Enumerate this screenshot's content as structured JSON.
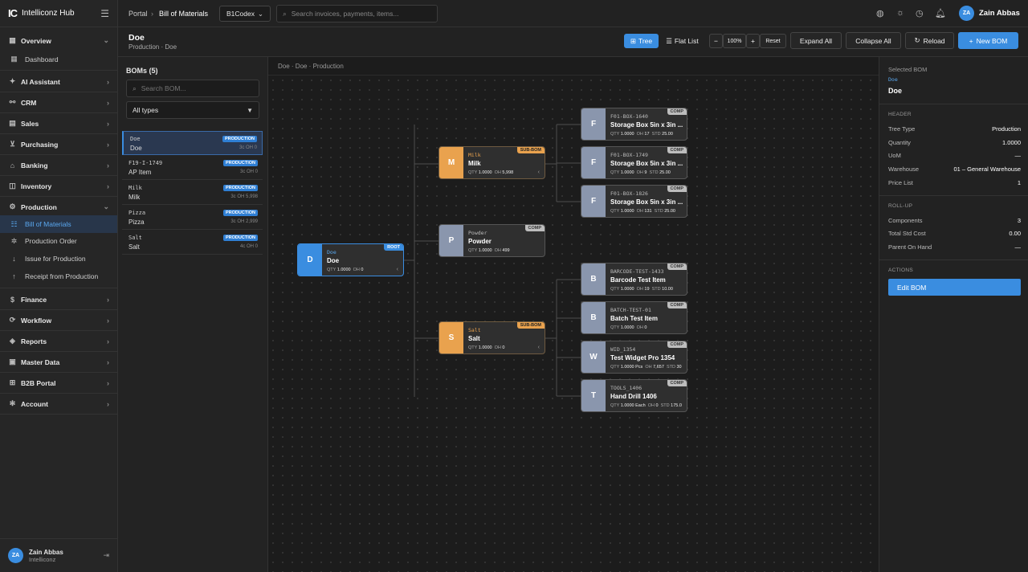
{
  "brand": {
    "logo": "IC",
    "name": "Intelliconz Hub"
  },
  "nav": {
    "groups": [
      {
        "label": "Overview",
        "icon": "grid-icon"
      },
      {
        "label": "AI Assistant",
        "icon": "sparkle-icon"
      },
      {
        "label": "CRM",
        "icon": "handshake-icon"
      },
      {
        "label": "Sales",
        "icon": "receipt-icon"
      },
      {
        "label": "Purchasing",
        "icon": "cart-icon"
      },
      {
        "label": "Banking",
        "icon": "bank-icon"
      },
      {
        "label": "Inventory",
        "icon": "box-icon"
      },
      {
        "label": "Production",
        "icon": "gear-icon"
      },
      {
        "label": "Finance",
        "icon": "dollar-icon"
      },
      {
        "label": "Workflow",
        "icon": "workflow-icon"
      },
      {
        "label": "Reports",
        "icon": "tag-icon"
      },
      {
        "label": "Master Data",
        "icon": "database-icon"
      },
      {
        "label": "B2B Portal",
        "icon": "portal-icon"
      },
      {
        "label": "Account",
        "icon": "settings-icon"
      }
    ],
    "sub_overview": [
      {
        "label": "Dashboard"
      }
    ],
    "sub_production": [
      {
        "label": "Bill of Materials"
      },
      {
        "label": "Production Order"
      },
      {
        "label": "Issue for Production"
      },
      {
        "label": "Receipt from Production"
      }
    ]
  },
  "user": {
    "initials": "ZA",
    "name": "Zain Abbas",
    "org": "Intelliconz"
  },
  "topbar": {
    "crumb_root": "Portal",
    "crumb_sep": "›",
    "crumb_page": "Bill of Materials",
    "company": "B1Codex",
    "search_placeholder": "Search invoices, payments, items..."
  },
  "page": {
    "title": "Doe",
    "subtitle": "Production · Doe"
  },
  "toolbar": {
    "tree": "Tree",
    "flat": "Flat List",
    "zoom_out": "−",
    "zoom": "100%",
    "zoom_in": "+",
    "reset": "Reset",
    "expand": "Expand All",
    "collapse": "Collapse All",
    "reload": "Reload",
    "new_bom": "New BOM"
  },
  "boms": {
    "header": "BOMs (5)",
    "search_placeholder": "Search BOM...",
    "type_filter": "All types",
    "items": [
      {
        "code": "Doe",
        "name": "Doe",
        "badge": "PRODUCTION",
        "meta": "3c OH 0"
      },
      {
        "code": "F19-I-1749",
        "name": "AP Item",
        "badge": "PRODUCTION",
        "meta": "3c OH 0"
      },
      {
        "code": "Milk",
        "name": "Milk",
        "badge": "PRODUCTION",
        "meta": "3c OH 5,998"
      },
      {
        "code": "Pizza",
        "name": "Pizza",
        "badge": "PRODUCTION",
        "meta": "3c OH 2,999"
      },
      {
        "code": "Salt",
        "name": "Salt",
        "badge": "PRODUCTION",
        "meta": "4c OH 0"
      }
    ]
  },
  "canvas": {
    "breadcrumb": "Doe · Doe · Production"
  },
  "tree": {
    "root": {
      "letter": "D",
      "code": "Doe",
      "title": "Doe",
      "tag": "ROOT",
      "qty": "1.0000",
      "oh": "0"
    },
    "level1": [
      {
        "letter": "M",
        "code": "Milk",
        "title": "Milk",
        "tag": "SUB-BOM",
        "qty": "1.0000",
        "oh": "5,998",
        "color": "orange"
      },
      {
        "letter": "P",
        "code": "Powder",
        "title": "Powder",
        "tag": "COMP",
        "qty": "1.0000",
        "oh": "499",
        "color": "gray"
      },
      {
        "letter": "S",
        "code": "Salt",
        "title": "Salt",
        "tag": "SUB-BOM",
        "qty": "1.0000",
        "oh": "0",
        "color": "orange"
      }
    ],
    "milk_children": [
      {
        "letter": "F",
        "code": "F01-BOX-1640",
        "title": "Storage Box 5in x 3in ...",
        "tag": "COMP",
        "qty": "1.0000",
        "oh": "17",
        "std": "25.00"
      },
      {
        "letter": "F",
        "code": "F01-BOX-1749",
        "title": "Storage Box 5in x 3in ...",
        "tag": "COMP",
        "qty": "1.0000",
        "oh": "9",
        "std": "25.00"
      },
      {
        "letter": "F",
        "code": "F01-BOX-1826",
        "title": "Storage Box 5in x 3in ...",
        "tag": "COMP",
        "qty": "1.0000",
        "oh": "131",
        "std": "25.00"
      }
    ],
    "salt_children": [
      {
        "letter": "B",
        "code": "BARCODE-TEST-1433",
        "title": "Barcode Test Item",
        "tag": "COMP",
        "qty": "1.0000",
        "oh": "19",
        "std": "10.00"
      },
      {
        "letter": "B",
        "code": "BATCH-TEST-01",
        "title": "Batch Test Item",
        "tag": "COMP",
        "qty": "1.0000",
        "oh": "0",
        "std": ""
      },
      {
        "letter": "W",
        "code": "WID_1354",
        "title": "Test Widget Pro 1354",
        "tag": "COMP",
        "qty": "1.0000 Pcs",
        "oh": "7,657",
        "std": "30"
      },
      {
        "letter": "T",
        "code": "TOOLS_1406",
        "title": "Hand Drill 1406",
        "tag": "COMP",
        "qty": "1.0000 Each",
        "oh": "0",
        "std": "175.0"
      }
    ],
    "labels": {
      "qty": "QTY",
      "oh": "OH",
      "std": "STD"
    }
  },
  "details": {
    "selected_label": "Selected BOM",
    "selected_code": "Doe",
    "selected_name": "Doe",
    "header_section": "HEADER",
    "header_rows": [
      {
        "k": "Tree Type",
        "v": "Production"
      },
      {
        "k": "Quantity",
        "v": "1.0000"
      },
      {
        "k": "UoM",
        "v": "—"
      },
      {
        "k": "Warehouse",
        "v": "01 – General Warehouse"
      },
      {
        "k": "Price List",
        "v": "1"
      }
    ],
    "rollup_section": "ROLL-UP",
    "rollup_rows": [
      {
        "k": "Components",
        "v": "3"
      },
      {
        "k": "Total Std Cost",
        "v": "0.00"
      },
      {
        "k": "Parent On Hand",
        "v": "—"
      }
    ],
    "actions_section": "ACTIONS",
    "edit_label": "Edit BOM"
  },
  "colors": {
    "accent": "#3a8de0",
    "subbom": "#e9a24e",
    "comp": "#8a96ad"
  }
}
